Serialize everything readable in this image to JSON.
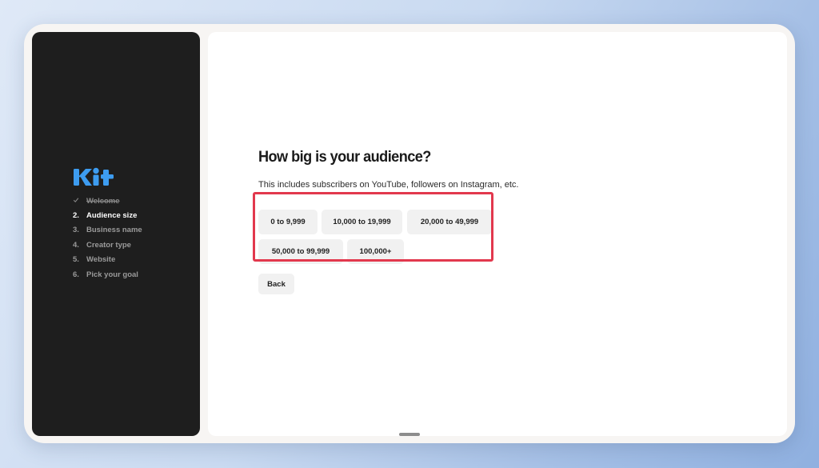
{
  "brand": {
    "logo_text": "kit",
    "logo_color": "#3d9cf0"
  },
  "steps": [
    {
      "number": "",
      "label": "Welcome",
      "status": "done",
      "icon": "check-icon"
    },
    {
      "number": "2.",
      "label": "Audience size",
      "status": "active"
    },
    {
      "number": "3.",
      "label": "Business name",
      "status": "pending"
    },
    {
      "number": "4.",
      "label": "Creator type",
      "status": "pending"
    },
    {
      "number": "5.",
      "label": "Website",
      "status": "pending"
    },
    {
      "number": "6.",
      "label": "Pick your goal",
      "status": "pending"
    }
  ],
  "question": {
    "title": "How big is your audience?",
    "subtitle": "This includes subscribers on YouTube, followers on Instagram, etc."
  },
  "options": [
    {
      "label": "0 to 9,999"
    },
    {
      "label": "10,000 to 19,999"
    },
    {
      "label": "20,000 to 49,999"
    },
    {
      "label": "50,000 to 99,999"
    },
    {
      "label": "100,000+"
    }
  ],
  "back_label": "Back",
  "colors": {
    "highlight": "#e2384d",
    "sidebar_bg": "#1e1e1e",
    "button_bg": "#f1f1f1"
  }
}
